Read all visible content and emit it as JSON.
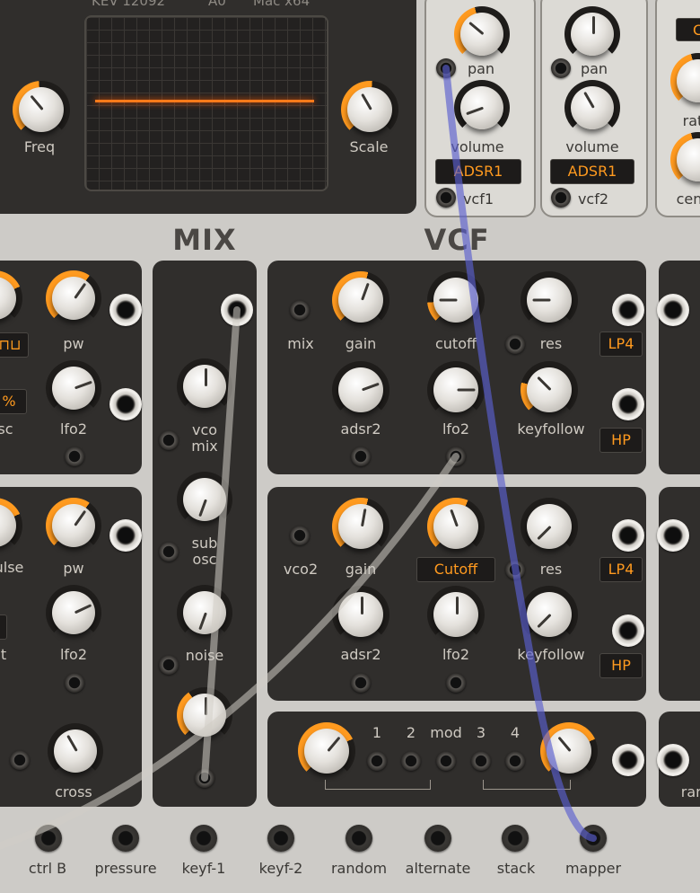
{
  "top_text": {
    "left": "KEV 12092",
    "mid": "A0",
    "right": "Mac x64"
  },
  "osc": {
    "freq_label": "Freq",
    "scale_label": "Scale"
  },
  "voice": {
    "ch1": {
      "pan": "pan",
      "volume": "volume",
      "env": "ADSR1",
      "vcf": "vcf1"
    },
    "ch2": {
      "pan": "pan",
      "volume": "volume",
      "env": "ADSR1",
      "vcf": "vcf2"
    },
    "ch3": {
      "top_btn": "C",
      "rate": "rat",
      "cent": "cen"
    }
  },
  "sections": {
    "mix": "MIX",
    "vcf": "VCF"
  },
  "left": {
    "pw1": "pw",
    "lfo2_1": "lfo2",
    "pct": "%",
    "osc_partial": "sc",
    "pulse_partial": "ulse",
    "pw2": "pw",
    "lfo2_2": "lfo2",
    "t_partial": "t",
    "cross": "cross"
  },
  "mix": {
    "vco_mix": "vco\nmix",
    "sub_osc": "sub\nosc",
    "noise": "noise"
  },
  "vcf1": {
    "mix": "mix",
    "gain": "gain",
    "cutoff": "cutoff",
    "res": "res",
    "adsr2": "adsr2",
    "lfo2": "lfo2",
    "keyfollow": "keyfollow",
    "lp4": "LP4",
    "hp": "HP"
  },
  "vcf2": {
    "vco2": "vco2",
    "gain": "gain",
    "cutoff_display": "Cutoff",
    "res": "res",
    "adsr2": "adsr2",
    "lfo2": "lfo2",
    "keyfollow": "keyfollow",
    "lp4": "LP4",
    "hp": "HP"
  },
  "mod": {
    "n1": "1",
    "n2": "2",
    "mod": "mod",
    "n3": "3",
    "n4": "4"
  },
  "right_partial": {
    "ran": "ran"
  },
  "bottom_inputs": [
    "ctrl B",
    "pressure",
    "keyf-1",
    "keyf-2",
    "random",
    "alternate",
    "stack",
    "mapper"
  ],
  "colors": {
    "accent": "#ff9a1f",
    "panel": "#302e2c",
    "body": "#cdcbc7",
    "cable_blue": "#5a5fd0"
  }
}
